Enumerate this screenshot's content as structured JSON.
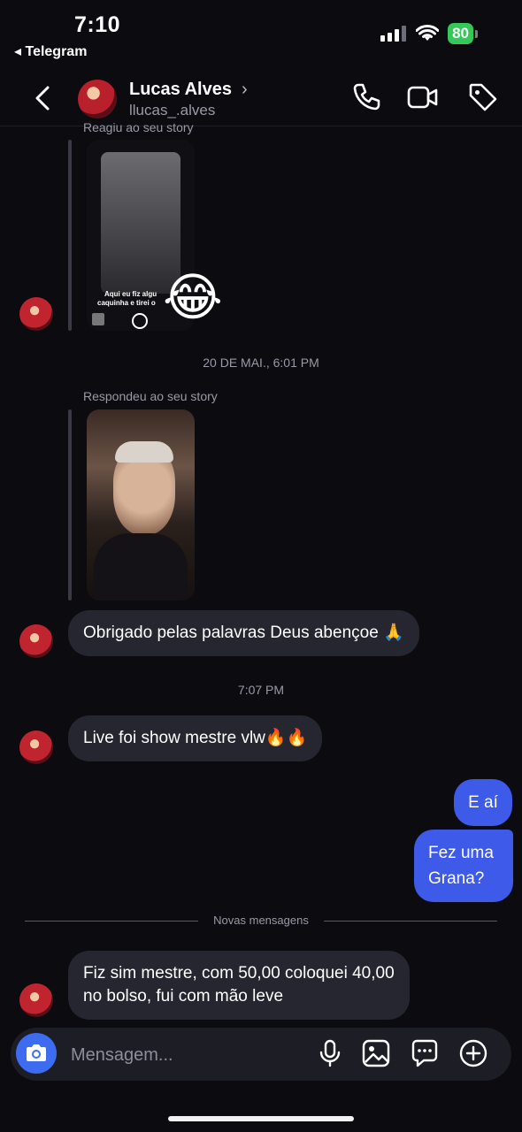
{
  "status_bar": {
    "time": "7:10",
    "back_app": "◂ Telegram",
    "battery": "80"
  },
  "header": {
    "name": "Lucas Alves",
    "chevron": "›",
    "username": "llucas_.alves"
  },
  "messages": {
    "reacted_label": "Reagiu ao seu story",
    "story1_caption_line1": "Aqui eu fiz algu",
    "story1_caption_line2": "caquinha e tirei o",
    "reaction_emoji": "😂",
    "timestamp1": "20 DE MAI., 6:01 PM",
    "replied_label": "Respondeu ao seu story",
    "incoming1": "Obrigado pelas palavras Deus abençoe 🙏",
    "timestamp2": "7:07 PM",
    "incoming2": "Live foi show mestre vlw🔥🔥",
    "outgoing1": "E aí",
    "outgoing2_line1": "Fez uma",
    "outgoing2_line2": "Grana?",
    "new_messages_label": "Novas mensagens",
    "incoming3_line1": "Fiz sim mestre, com 50,00 coloquei 40,00",
    "incoming3_line2": "no bolso, fui com mão leve"
  },
  "composer": {
    "placeholder": "Mensagem..."
  }
}
